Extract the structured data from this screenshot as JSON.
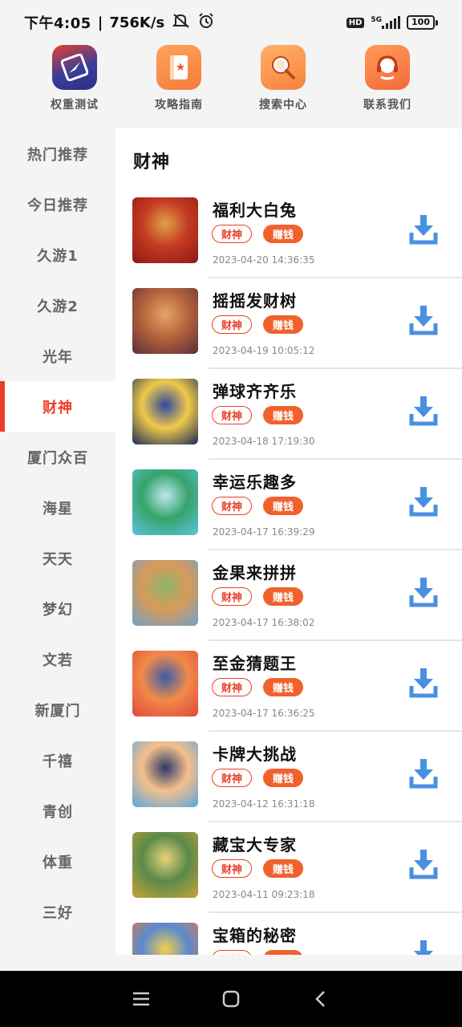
{
  "status_bar": {
    "time": "下午4:05",
    "net_speed": "756K/s",
    "hd_badge": "HD",
    "network": "5G",
    "battery": "100"
  },
  "shortcuts": [
    {
      "label": "权重测试",
      "icon": "compass-icon",
      "color": "#3b3d9a"
    },
    {
      "label": "攻略指南",
      "icon": "book-icon",
      "color": "#f47c3c"
    },
    {
      "label": "搜索中心",
      "icon": "search-icon",
      "color": "#f6833e"
    },
    {
      "label": "联系我们",
      "icon": "headset-icon",
      "color": "#f56a3a"
    }
  ],
  "sidebar": {
    "items": [
      {
        "label": "热门推荐"
      },
      {
        "label": "今日推荐"
      },
      {
        "label": "久游1"
      },
      {
        "label": "久游2"
      },
      {
        "label": "光年"
      },
      {
        "label": "财神",
        "active": true
      },
      {
        "label": "厦门众百"
      },
      {
        "label": "海星"
      },
      {
        "label": "天天"
      },
      {
        "label": "梦幻"
      },
      {
        "label": "文若"
      },
      {
        "label": "新厦门"
      },
      {
        "label": "千禧"
      },
      {
        "label": "青创"
      },
      {
        "label": "体重"
      },
      {
        "label": "三好"
      }
    ]
  },
  "main": {
    "category_title": "财神",
    "apps": [
      {
        "name": "福利大白兔",
        "tag1": "财神",
        "tag2": "赚钱",
        "date": "2023-04-20  14:36:35",
        "thumb": [
          "#8a1a16",
          "#c53a22",
          "#e0a14a"
        ]
      },
      {
        "name": "摇摇发财树",
        "tag1": "财神",
        "tag2": "赚钱",
        "date": "2023-04-19  10:05:12",
        "thumb": [
          "#5b2d3a",
          "#b5643c",
          "#e8a36a"
        ]
      },
      {
        "name": "弹球齐齐乐",
        "tag1": "财神",
        "tag2": "赚钱",
        "date": "2023-04-18  17:19:30",
        "thumb": [
          "#1c2a5a",
          "#f0c94a",
          "#2e4aa0"
        ]
      },
      {
        "name": "幸运乐趣多",
        "tag1": "财神",
        "tag2": "赚钱",
        "date": "2023-04-17  16:39:29",
        "thumb": [
          "#5ec3df",
          "#36a36a",
          "#bfe8ef"
        ]
      },
      {
        "name": "金果来拼拼",
        "tag1": "财神",
        "tag2": "赚钱",
        "date": "2023-04-17  16:38:02",
        "thumb": [
          "#6fa1c8",
          "#d89a5a",
          "#8bb56a"
        ]
      },
      {
        "name": "至金猜题王",
        "tag1": "财神",
        "tag2": "赚钱",
        "date": "2023-04-17  16:36:25",
        "thumb": [
          "#e0493a",
          "#f08a4a",
          "#3a5ea8"
        ]
      },
      {
        "name": "卡牌大挑战",
        "tag1": "财神",
        "tag2": "赚钱",
        "date": "2023-04-12  16:31:18",
        "thumb": [
          "#5aa5e0",
          "#f5c08a",
          "#2a3a6a"
        ]
      },
      {
        "name": "藏宝大专家",
        "tag1": "财神",
        "tag2": "赚钱",
        "date": "2023-04-11  09:23:18",
        "thumb": [
          "#c8a23a",
          "#5a8a4a",
          "#e8d27a"
        ]
      },
      {
        "name": "宝箱的秘密",
        "tag1": "财神",
        "tag2": "赚钱",
        "date": "",
        "thumb": [
          "#f07a3a",
          "#5a8ad0",
          "#f5d04a"
        ]
      }
    ]
  },
  "colors": {
    "accent": "#e8402a",
    "tag_fill": "#f0612c",
    "download": "#4a8fe0"
  }
}
